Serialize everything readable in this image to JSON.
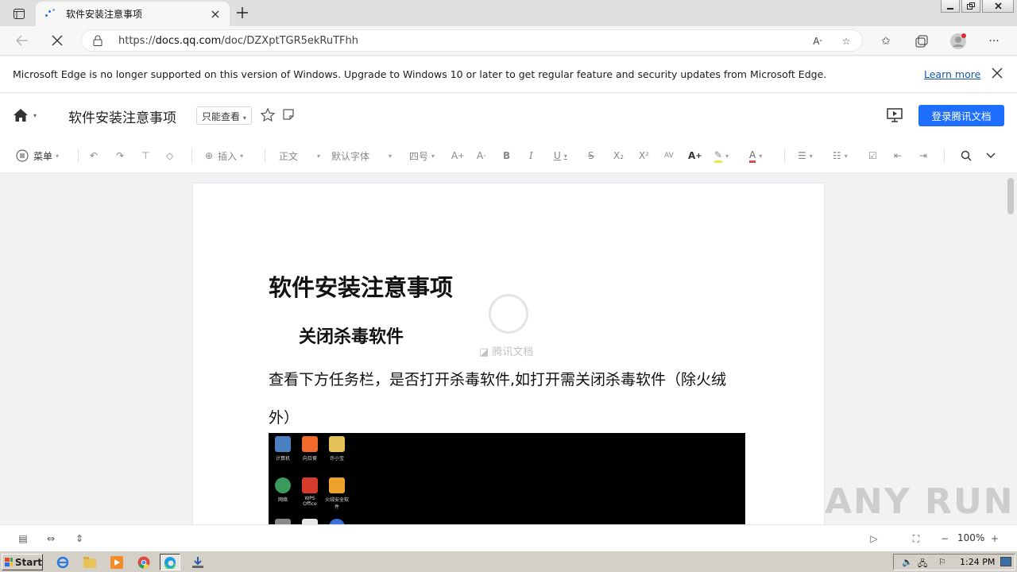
{
  "browser": {
    "tab_title": "软件安装注意事项",
    "url_prefix": "https://",
    "url_host": "docs.qq.com",
    "url_path": "/doc/DZXptTGR5ekRuTFhh"
  },
  "infobar": {
    "message": "Microsoft Edge is no longer supported on this version of Windows. Upgrade to Windows 10 or later to get regular feature and security updates from Microsoft Edge.",
    "learn_more": "Learn more"
  },
  "doc_header": {
    "title": "软件安装注意事项",
    "permission": "只能查看",
    "login_button": "登录腾讯文档"
  },
  "toolbar": {
    "menu": "菜单",
    "insert": "插入",
    "paragraph_style": "正文",
    "font": "默认字体",
    "font_size": "四号",
    "sub": "X₂",
    "sup": "X²",
    "spacing": "AV"
  },
  "document": {
    "heading": "软件安装注意事项",
    "subheading": "关闭杀毒软件",
    "paragraph": "查看下方任务栏，是否打开杀毒软件,如打开需关闭杀毒软件（除火绒外）",
    "desktop_icons": [
      {
        "label": "计算机",
        "color": "#4a7fc1"
      },
      {
        "label": "向日葵",
        "color": "#f06b2b"
      },
      {
        "label": "许小宝",
        "color": "#e6c35a"
      },
      {
        "label": "网络",
        "color": "#3b9b5c"
      },
      {
        "label": "WPS Office",
        "color": "#d63b2b"
      },
      {
        "label": "火绒安全软件",
        "color": "#f0a12b"
      }
    ]
  },
  "loading": {
    "label": "腾讯文档"
  },
  "statusbar": {
    "zoom": "100%"
  },
  "taskbar": {
    "start": "Start",
    "time": "1:24 PM"
  },
  "watermark": "ANY RUN",
  "colors": {
    "accent": "#1e6fff",
    "link": "#1557b0"
  }
}
